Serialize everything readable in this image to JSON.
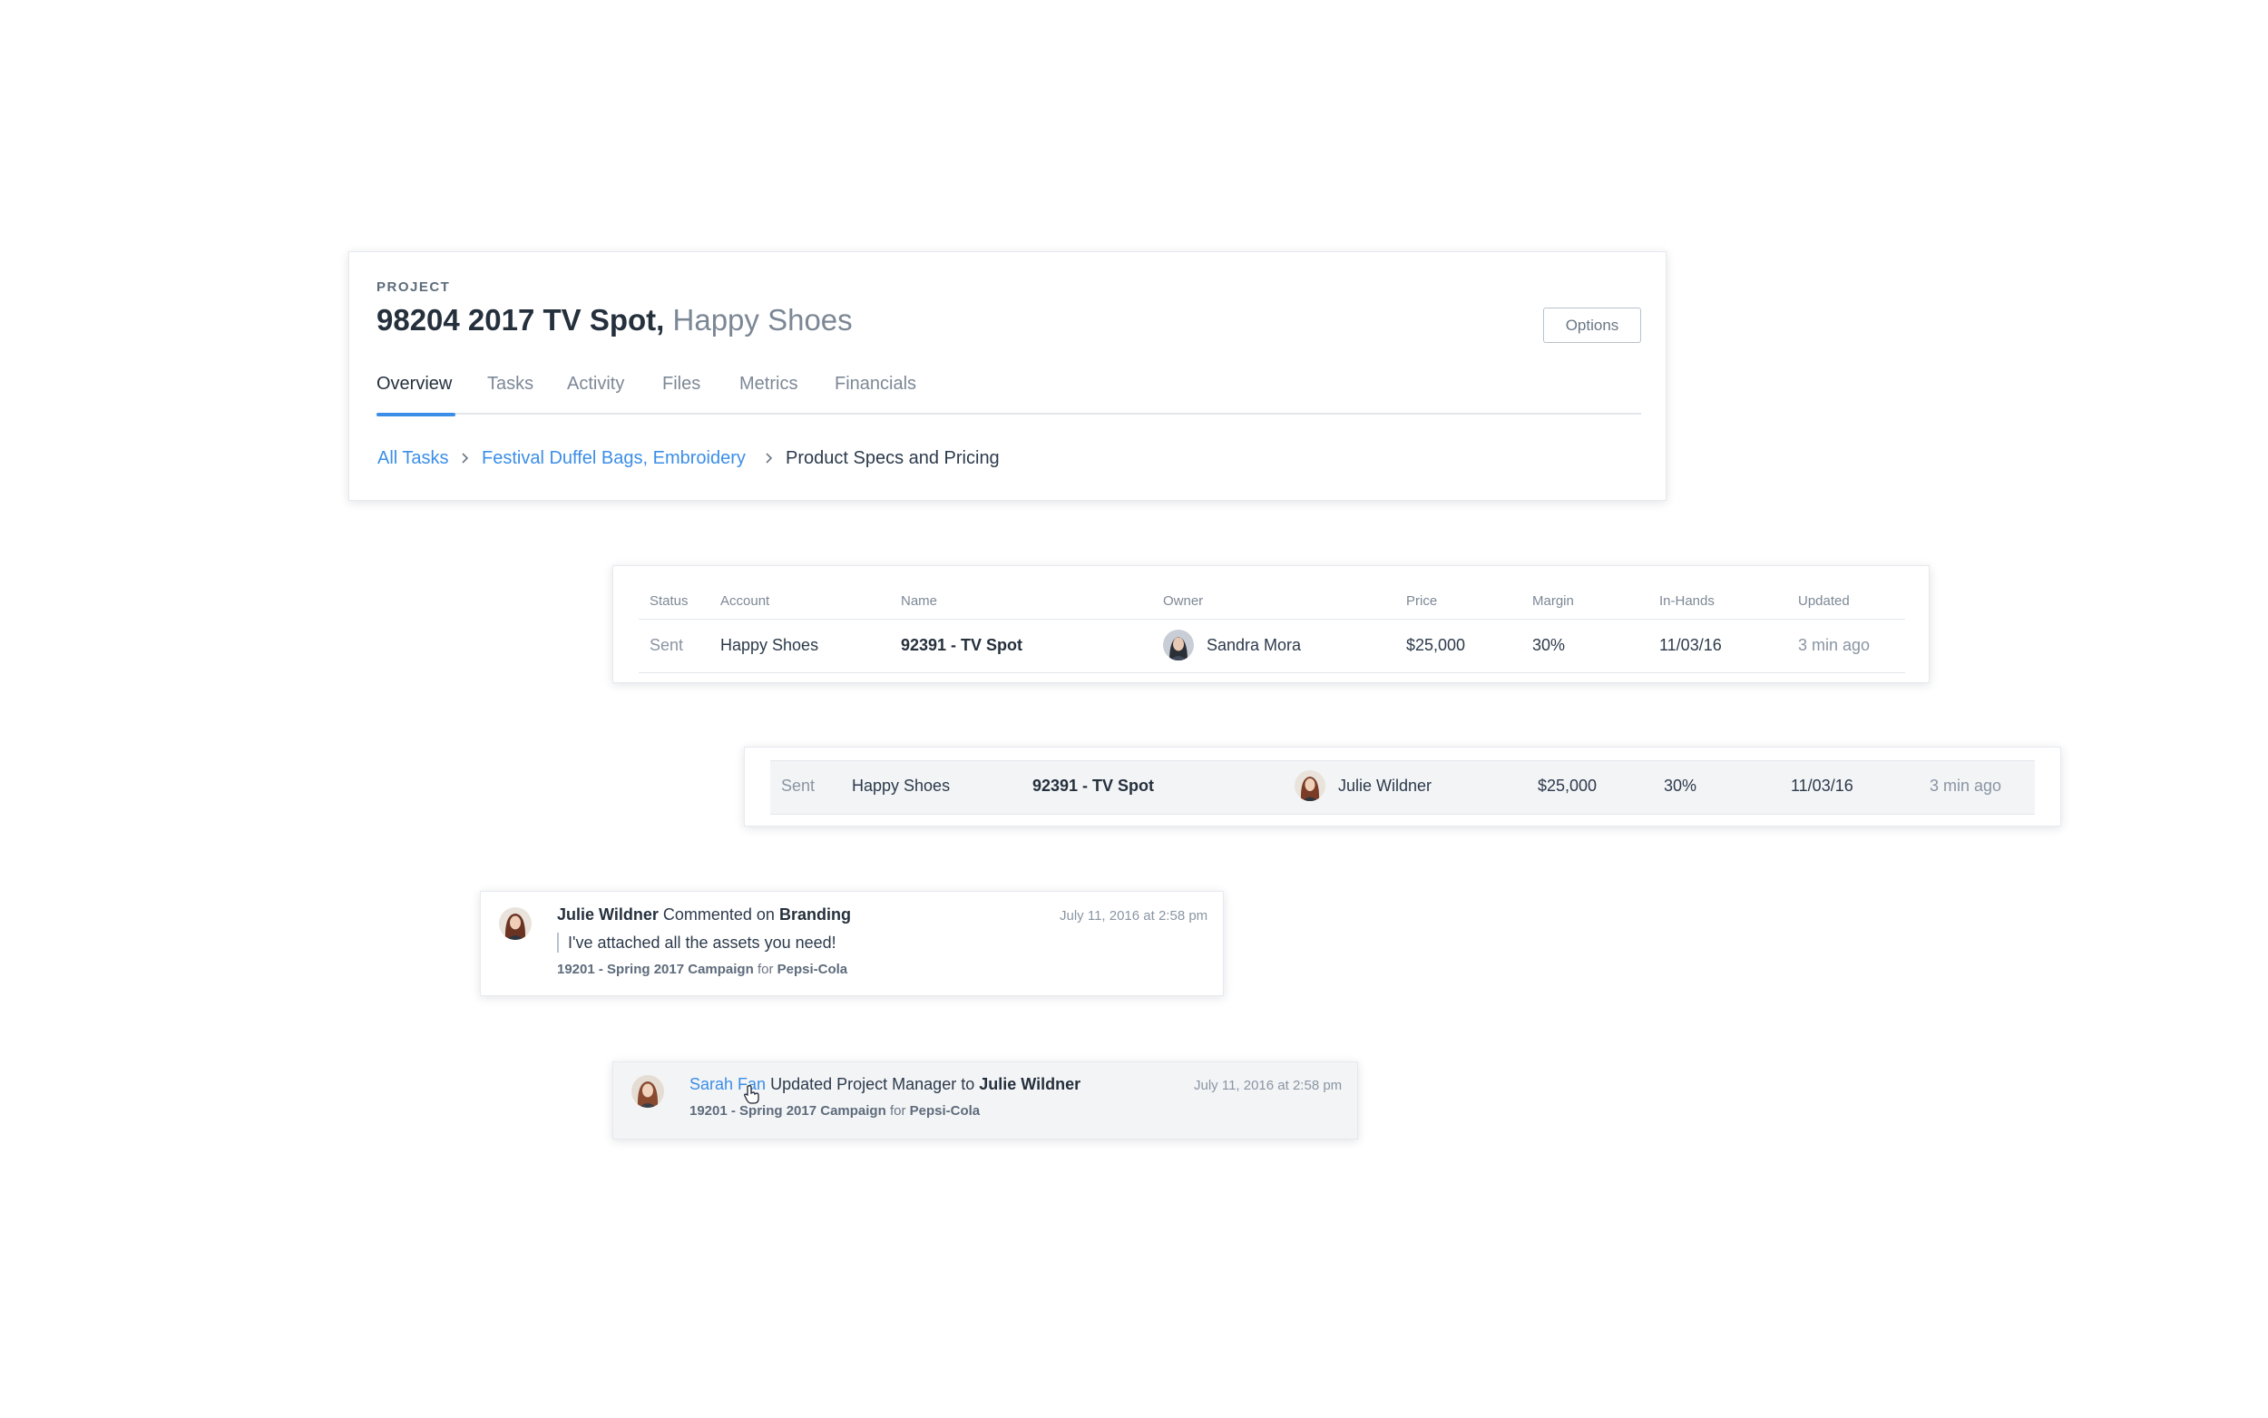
{
  "project": {
    "label": "PROJECT",
    "code": "98204 2017 TV Spot,",
    "client": "Happy Shoes",
    "options_label": "Options",
    "tabs": [
      {
        "label": "Overview",
        "active": true
      },
      {
        "label": "Tasks",
        "active": false
      },
      {
        "label": "Activity",
        "active": false
      },
      {
        "label": "Files",
        "active": false
      },
      {
        "label": "Metrics",
        "active": false
      },
      {
        "label": "Financials",
        "active": false
      }
    ],
    "breadcrumb": [
      "All Tasks",
      "Festival Duffel Bags, Embroidery",
      "Product Specs and Pricing"
    ]
  },
  "table": {
    "headers": [
      "Status",
      "Account",
      "Name",
      "Owner",
      "Price",
      "Margin",
      "In-Hands",
      "Updated"
    ],
    "row": {
      "status": "Sent",
      "account": "Happy Shoes",
      "name": "92391 - TV Spot",
      "owner": "Sandra Mora",
      "price": "$25,000",
      "margin": "30%",
      "in_hands": "11/03/16",
      "updated": "3 min ago"
    }
  },
  "hover_row": {
    "status": "Sent",
    "account": "Happy Shoes",
    "name": "92391 - TV Spot",
    "owner": "Julie Wildner",
    "price": "$25,000",
    "margin": "30%",
    "in_hands": "11/03/16",
    "updated": "3 min ago"
  },
  "comment_activity": {
    "actor": "Julie Wildner",
    "verb": "Commented on",
    "target": "Branding",
    "time": "July 11, 2016 at 2:58 pm",
    "quote": "I've attached all the assets you need!",
    "project": "19201 - Spring 2017 Campaign",
    "for": "for",
    "client": "Pepsi-Cola"
  },
  "update_activity": {
    "actor": "Sarah Fan",
    "verb": "Updated Project Manager to",
    "target": "Julie Wildner",
    "time": "July 11, 2016 at 2:58 pm",
    "project": "19201 - Spring 2017 Campaign",
    "for": "for",
    "client": "Pepsi-Cola"
  },
  "colors": {
    "accent": "#3b8ee8",
    "text_dark": "#25303d",
    "text_muted": "#8a95a3",
    "row_hover": "#f3f4f6"
  }
}
